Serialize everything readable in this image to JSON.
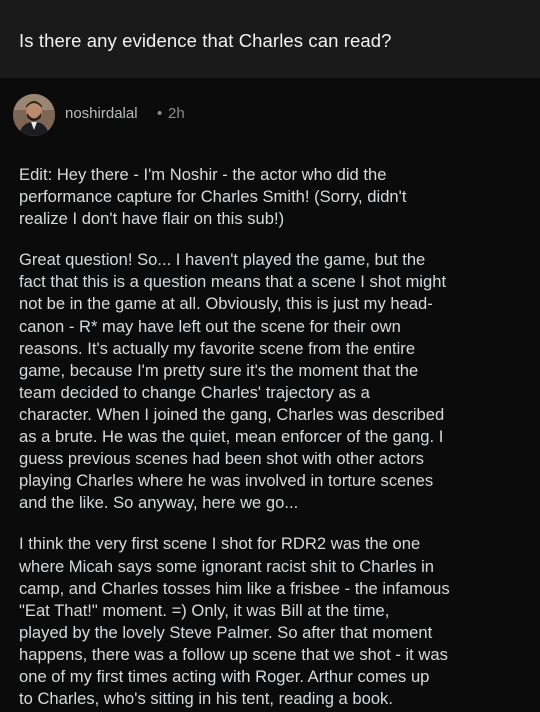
{
  "post": {
    "title": "Is there any evidence that Charles can read?"
  },
  "comment": {
    "username": "noshirdalal",
    "separator": "•",
    "timestamp": "2h",
    "paragraphs": [
      "Edit: Hey there - I'm Noshir - the actor who did the\nperformance capture for Charles Smith! (Sorry, didn't\nrealize I don't have flair on this sub!)",
      "Great question! So... I haven't played the game, but the\nfact that this is a question means that a scene I shot might\nnot be in the game at all. Obviously, this is just my head-\ncanon - R* may have left out the scene for their own\nreasons. It's actually my favorite scene from the entire\ngame, because I'm pretty sure it's the moment that the\nteam decided to change Charles' trajectory as a\ncharacter. When I joined the gang, Charles was described\nas a brute. He was the quiet, mean enforcer of the gang. I\nguess previous scenes had been shot with other actors\nplaying Charles where he was involved in torture scenes\nand the like. So anyway, here we go...",
      "I think the very first scene I shot for RDR2 was the one\nwhere Micah says some ignorant racist shit to Charles in\ncamp, and Charles tosses him like a frisbee - the infamous\n\"Eat That!\" moment.  =)  Only, it was Bill at the time,\nplayed by the lovely Steve Palmer. So after that moment\nhappens, there was a follow up scene that we shot - it was\none of my first times acting with Roger. Arthur comes up\nto Charles, who's sitting in his tent, reading a book."
    ]
  }
}
